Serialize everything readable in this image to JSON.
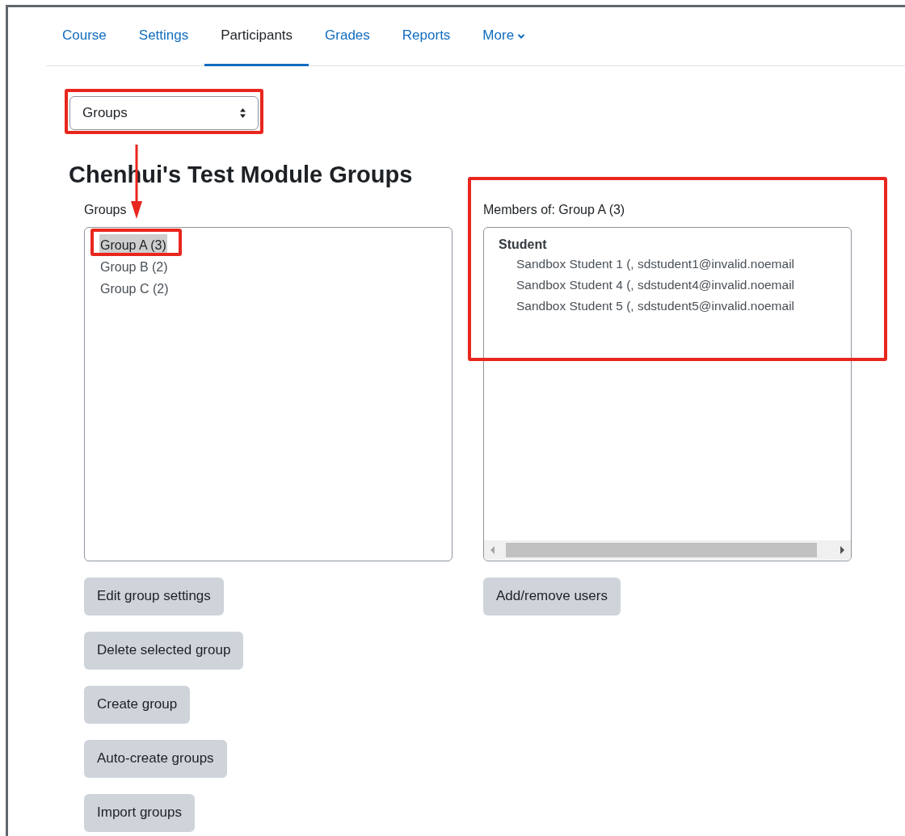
{
  "nav": {
    "tabs": [
      {
        "label": "Course",
        "selected": false,
        "kind": "link"
      },
      {
        "label": "Settings",
        "selected": false,
        "kind": "link"
      },
      {
        "label": "Participants",
        "selected": true,
        "kind": "link"
      },
      {
        "label": "Grades",
        "selected": false,
        "kind": "link"
      },
      {
        "label": "Reports",
        "selected": false,
        "kind": "link"
      },
      {
        "label": "More",
        "selected": false,
        "kind": "dropdown"
      }
    ]
  },
  "view_select": {
    "value": "Groups"
  },
  "heading": "Chenhui's Test Module Groups",
  "groups_panel": {
    "label": "Groups",
    "items": [
      {
        "label": "Group A (3)",
        "selected": true
      },
      {
        "label": "Group B (2)",
        "selected": false
      },
      {
        "label": "Group C (2)",
        "selected": false
      }
    ],
    "buttons": [
      "Edit group settings",
      "Delete selected group",
      "Create group",
      "Auto-create groups",
      "Import groups"
    ]
  },
  "members_panel": {
    "label": "Members of: Group A (3)",
    "role": "Student",
    "members": [
      "Sandbox Student 1 (, sdstudent1@invalid.noemail",
      "Sandbox Student 4 (, sdstudent4@invalid.noemail",
      "Sandbox Student 5 (, sdstudent5@invalid.noemail"
    ],
    "buttons": [
      "Add/remove users"
    ]
  }
}
